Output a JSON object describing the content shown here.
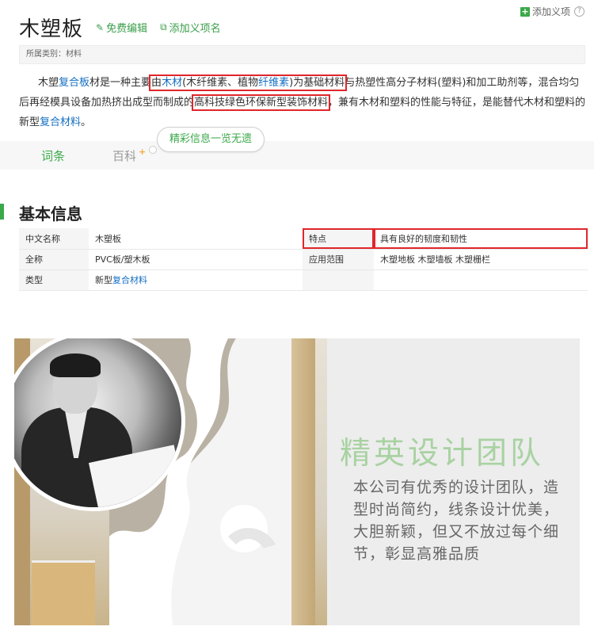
{
  "header": {
    "add_tag_label": "添加义项",
    "title": "木塑板",
    "edit_label": "免费编辑",
    "add_entry_label": "添加义项名",
    "category": "所属类别：材料"
  },
  "intro": {
    "p1": "木塑",
    "link_fuheban": "复合板",
    "p2": "材是一种主要",
    "p3": "由",
    "link_mucai": "木材",
    "p4": "(木纤维素、植物",
    "link_xianweisu": "纤维素",
    "p5": ")为基础材料",
    "p6": "与热塑性高分子材料(塑料)和加工助剂等，混合均匀后再经模具设备加热挤出成型而制成的",
    "p7": "高科技绿色环保新型装饰材料",
    "p8": "，兼有木材和塑料的性能与特征，是能替代木材和塑料的新型",
    "link_fuhecailiao": "复合材料",
    "p9": "。"
  },
  "tabs": {
    "active": "词条",
    "inactive": "百科",
    "sup": "+",
    "bubble": "精彩信息一览无遗"
  },
  "basic_info": {
    "title": "基本信息",
    "rows": [
      {
        "k1": "中文名称",
        "v1": "木塑板",
        "k2": "特点",
        "v2": "具有良好的韧度和韧性"
      },
      {
        "k1": "全称",
        "v1": "PVC板/塑木板",
        "k2": "应用范围",
        "v2": "木塑地板 木塑墙板 木塑栅栏"
      },
      {
        "k1": "类型",
        "v1_pre": "新型",
        "v1_link": "复合材料",
        "k2": "",
        "v2": ""
      }
    ]
  },
  "banner": {
    "title": "精英设计团队",
    "desc": "本公司有优秀的设计团队，造型时尚简约，线条设计优美，大胆新颖，但又不放过每个细节，彰显高雅品质"
  },
  "colors": {
    "accent_green": "#3ba94a",
    "link_blue": "#136ec2",
    "highlight_red": "#e0262b"
  }
}
